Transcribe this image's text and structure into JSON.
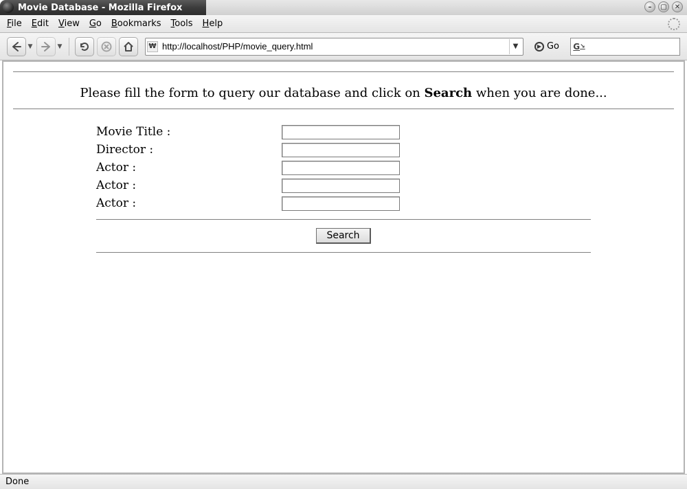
{
  "window": {
    "title": "Movie Database - Mozilla Firefox",
    "controls": {
      "minimize": "–",
      "maximize": "▢",
      "close": "✕"
    }
  },
  "menu": {
    "file": "File",
    "edit": "Edit",
    "view": "View",
    "go": "Go",
    "bookmarks": "Bookmarks",
    "tools": "Tools",
    "help": "Help"
  },
  "toolbar": {
    "url": "http://localhost/PHP/movie_query.html",
    "go_label": "Go"
  },
  "page": {
    "headline_pre": "Please fill the form to query our database and click on ",
    "headline_bold": "Search",
    "headline_post": " when you are done...",
    "fields": {
      "movie_title": "Movie Title :",
      "director": "Director :",
      "actor1": "Actor :",
      "actor2": "Actor :",
      "actor3": "Actor :"
    },
    "search_button": "Search"
  },
  "status": {
    "text": "Done"
  }
}
